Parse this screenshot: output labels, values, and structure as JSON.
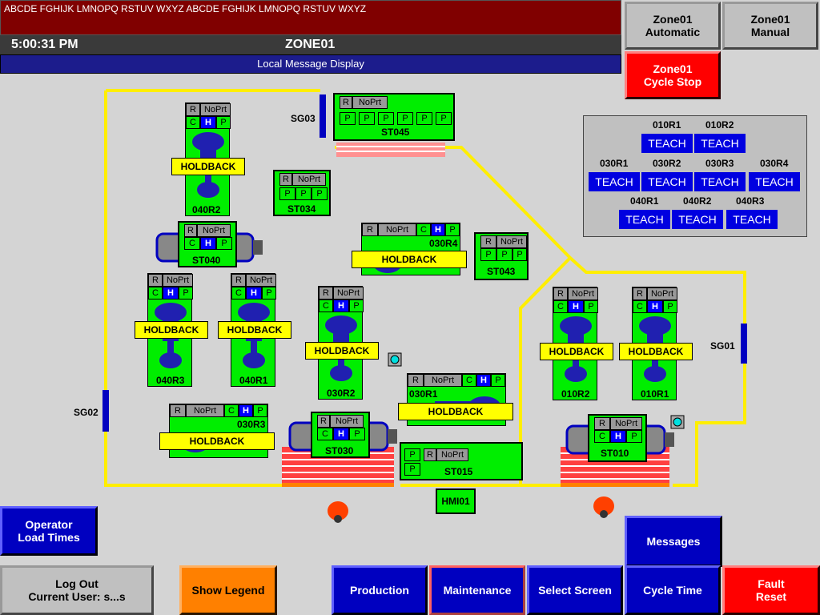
{
  "banner": {
    "text": "ABCDE FGHIJK LMNOPQ RSTUV WXYZ ABCDE FGHIJK LMNOPQ RSTUV WXYZ"
  },
  "header": {
    "time": "5:00:31 PM",
    "zone": "ZONE01",
    "local_message": "Local Message Display"
  },
  "top_buttons": {
    "automatic": "Zone01\nAutomatic",
    "manual": "Zone01\nManual",
    "cycle_stop": "Zone01\nCycle Stop"
  },
  "gates": {
    "sg01": "SG01",
    "sg02": "SG02",
    "sg03": "SG03"
  },
  "cells": {
    "r": "R",
    "noprt": "NoPrt",
    "c": "C",
    "h": "H",
    "p": "P"
  },
  "holdback": "HOLDBACK",
  "stations": {
    "st045": "ST045",
    "st034": "ST034",
    "st040": "ST040",
    "st043": "ST043",
    "st030": "ST030",
    "st015": "ST015",
    "st010": "ST010",
    "hmi01": "HMI01"
  },
  "robots": {
    "r040R2": "040R2",
    "r040R3": "040R3",
    "r040R1": "040R1",
    "r030R4": "030R4",
    "r030R2": "030R2",
    "r030R1": "030R1",
    "r030R3": "030R3",
    "r010R2": "010R2",
    "r010R1": "010R1"
  },
  "teach": {
    "button_label": "TEACH",
    "labels": {
      "r010R1": "010R1",
      "r010R2": "010R2",
      "r030R1": "030R1",
      "r030R2": "030R2",
      "r030R3": "030R3",
      "r030R4": "030R4",
      "r040R1": "040R1",
      "r040R2": "040R2",
      "r040R3": "040R3"
    }
  },
  "bottom_buttons": {
    "operator_load": "Operator\nLoad Times",
    "messages": "Messages",
    "logout": "Log Out\nCurrent User: s...s",
    "show_legend": "Show Legend",
    "production": "Production",
    "maintenance": "Maintenance",
    "select_screen": "Select Screen",
    "cycle_time": "Cycle Time",
    "fault_reset": "Fault\nReset"
  },
  "colors": {
    "active_green": "#00ee00",
    "hold_yellow": "#ffff00",
    "h_blue": "#0000ff",
    "path_yellow": "#ffee00"
  }
}
